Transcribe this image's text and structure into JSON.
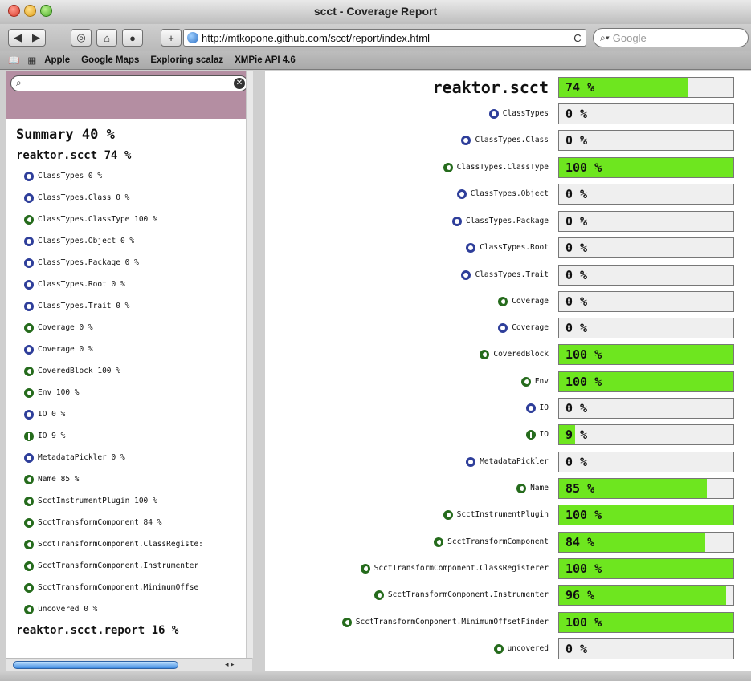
{
  "window": {
    "title": "scct - Coverage Report"
  },
  "toolbar": {
    "url": "http://mtkopone.github.com/scct/report/index.html",
    "reload_glyph": "C",
    "search_placeholder": "Google"
  },
  "bookmarks": [
    "Apple",
    "Google Maps",
    "Exploring scalaz",
    "XMPie API 4.6"
  ],
  "colors": {
    "fill": "#6ee61f",
    "sidebar": "#b48ea2"
  },
  "sidebar": {
    "summary": "Summary 40 %",
    "package": "reaktor.scct 74 %",
    "items": [
      {
        "icon": "object-icon",
        "label": "ClassTypes 0 %"
      },
      {
        "icon": "object-icon",
        "label": "ClassTypes.Class 0 %"
      },
      {
        "icon": "class-icon",
        "label": "ClassTypes.ClassType 100 %"
      },
      {
        "icon": "object-icon",
        "label": "ClassTypes.Object 0 %"
      },
      {
        "icon": "object-icon",
        "label": "ClassTypes.Package 0 %"
      },
      {
        "icon": "object-icon",
        "label": "ClassTypes.Root 0 %"
      },
      {
        "icon": "object-icon",
        "label": "ClassTypes.Trait 0 %"
      },
      {
        "icon": "class-icon",
        "label": "Coverage 0 %"
      },
      {
        "icon": "object-icon",
        "label": "Coverage 0 %"
      },
      {
        "icon": "class-icon",
        "label": "CoveredBlock 100 %"
      },
      {
        "icon": "class-icon",
        "label": "Env 100 %"
      },
      {
        "icon": "object-icon",
        "label": "IO 0 %"
      },
      {
        "icon": "trait-icon",
        "label": "IO 9 %"
      },
      {
        "icon": "object-icon",
        "label": "MetadataPickler 0 %"
      },
      {
        "icon": "class-icon",
        "label": "Name 85 %"
      },
      {
        "icon": "class-icon",
        "label": "ScctInstrumentPlugin 100 %"
      },
      {
        "icon": "class-icon",
        "label": "ScctTransformComponent 84 %"
      },
      {
        "icon": "class-icon",
        "label": "ScctTransformComponent.ClassRegiste:"
      },
      {
        "icon": "class-icon",
        "label": "ScctTransformComponent.Instrumenter"
      },
      {
        "icon": "class-icon",
        "label": "ScctTransformComponent.MinimumOffse"
      },
      {
        "icon": "class-icon",
        "label": "uncovered 0 %"
      }
    ],
    "footer_package": "reaktor.scct.report 16 %"
  },
  "report": {
    "rows": [
      {
        "label": "reaktor.scct",
        "pct": "74 %",
        "value": 74,
        "icon": "",
        "top": true
      },
      {
        "label": "ClassTypes",
        "pct": "0 %",
        "value": 0,
        "icon": "object-icon"
      },
      {
        "label": "ClassTypes.Class",
        "pct": "0 %",
        "value": 0,
        "icon": "object-icon"
      },
      {
        "label": "ClassTypes.ClassType",
        "pct": "100 %",
        "value": 100,
        "icon": "class-icon"
      },
      {
        "label": "ClassTypes.Object",
        "pct": "0 %",
        "value": 0,
        "icon": "object-icon"
      },
      {
        "label": "ClassTypes.Package",
        "pct": "0 %",
        "value": 0,
        "icon": "object-icon"
      },
      {
        "label": "ClassTypes.Root",
        "pct": "0 %",
        "value": 0,
        "icon": "object-icon"
      },
      {
        "label": "ClassTypes.Trait",
        "pct": "0 %",
        "value": 0,
        "icon": "object-icon"
      },
      {
        "label": "Coverage",
        "pct": "0 %",
        "value": 0,
        "icon": "class-icon"
      },
      {
        "label": "Coverage",
        "pct": "0 %",
        "value": 0,
        "icon": "object-icon"
      },
      {
        "label": "CoveredBlock",
        "pct": "100 %",
        "value": 100,
        "icon": "class-icon"
      },
      {
        "label": "Env",
        "pct": "100 %",
        "value": 100,
        "icon": "class-icon"
      },
      {
        "label": "IO",
        "pct": "0 %",
        "value": 0,
        "icon": "object-icon"
      },
      {
        "label": "IO",
        "pct": "9 %",
        "value": 9,
        "icon": "trait-icon"
      },
      {
        "label": "MetadataPickler",
        "pct": "0 %",
        "value": 0,
        "icon": "object-icon"
      },
      {
        "label": "Name",
        "pct": "85 %",
        "value": 85,
        "icon": "class-icon"
      },
      {
        "label": "ScctInstrumentPlugin",
        "pct": "100 %",
        "value": 100,
        "icon": "class-icon"
      },
      {
        "label": "ScctTransformComponent",
        "pct": "84 %",
        "value": 84,
        "icon": "class-icon"
      },
      {
        "label": "ScctTransformComponent.ClassRegisterer",
        "pct": "100 %",
        "value": 100,
        "icon": "class-icon"
      },
      {
        "label": "ScctTransformComponent.Instrumenter",
        "pct": "96 %",
        "value": 96,
        "icon": "class-icon"
      },
      {
        "label": "ScctTransformComponent.MinimumOffsetFinder",
        "pct": "100 %",
        "value": 100,
        "icon": "class-icon"
      },
      {
        "label": "uncovered",
        "pct": "0 %",
        "value": 0,
        "icon": "class-icon"
      }
    ]
  }
}
